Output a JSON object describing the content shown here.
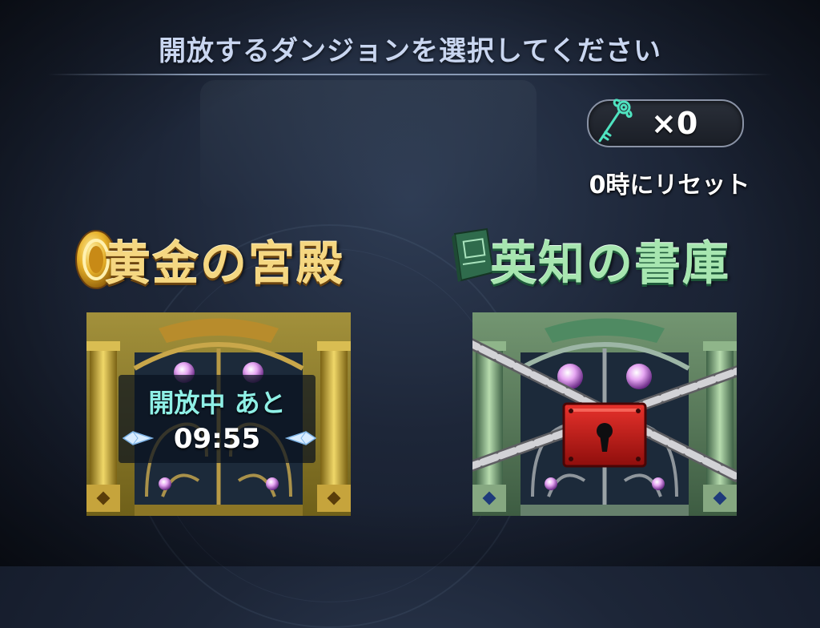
{
  "header": {
    "title": "開放するダンジョンを選択してください"
  },
  "keys": {
    "count_text": "×0",
    "reset_text": "0時にリセット",
    "icon": "key-icon",
    "color": "#4fe3c0"
  },
  "dungeons": [
    {
      "title": "黄金の宮殿",
      "icon": "gold-coin-icon",
      "theme_color": "#e8c04a",
      "state": "open",
      "status_label": "開放中 あと",
      "timer": "09:55"
    },
    {
      "title": "英知の書庫",
      "icon": "green-book-icon",
      "theme_color": "#7fcf93",
      "state": "locked",
      "lock_icon": "padlock-icon"
    }
  ]
}
